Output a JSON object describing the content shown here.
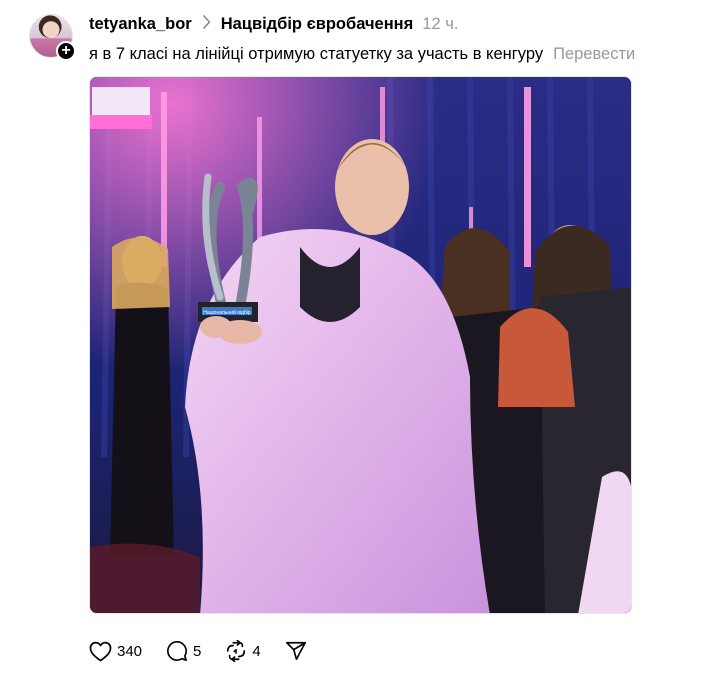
{
  "post": {
    "username": "tetyanka_bor",
    "topic": "Нацвідбір євробачення",
    "time": "12 ч.",
    "text": "я в 7 класі на лінійці отримую статуетку за участь в кенгуру",
    "translate_label": "Перевести"
  },
  "media": {
    "trophy_caption": "Національний відбір"
  },
  "actions": {
    "likes": "340",
    "replies": "5",
    "reposts": "4"
  },
  "icons": {
    "follow": "plus-icon",
    "chevron": "chevron-right-icon",
    "like": "heart-icon",
    "reply": "comment-icon",
    "repost": "repost-icon",
    "share": "send-icon"
  },
  "colors": {
    "text": "#000000",
    "muted": "#999999",
    "background": "#ffffff"
  }
}
